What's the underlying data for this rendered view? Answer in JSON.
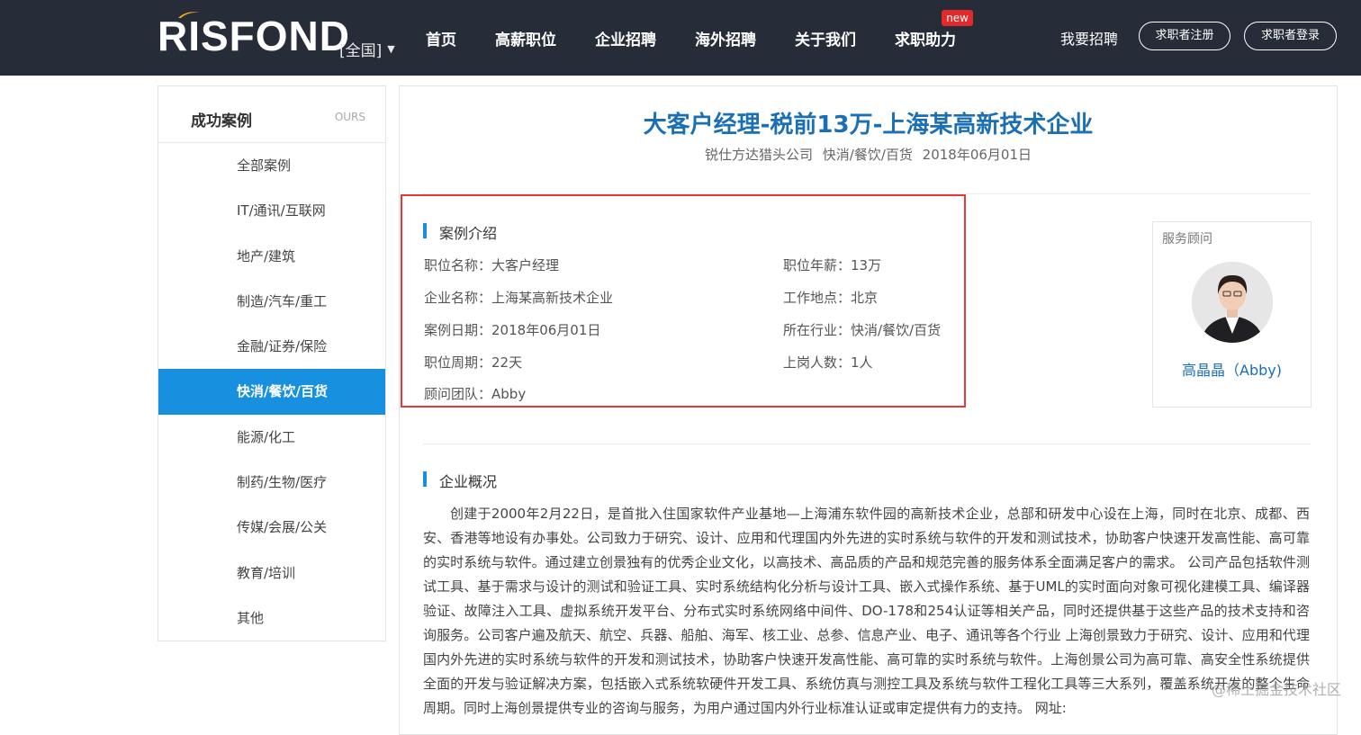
{
  "header": {
    "logo": "RISFOND",
    "region": "[全国]",
    "nav": [
      {
        "label": "首页"
      },
      {
        "label": "高薪职位"
      },
      {
        "label": "企业招聘"
      },
      {
        "label": "海外招聘"
      },
      {
        "label": "关于我们"
      },
      {
        "label": "求职助力",
        "badge": "new"
      }
    ],
    "recruit": "我要招聘",
    "register": "求职者注册",
    "login": "求职者登录"
  },
  "sidebar": {
    "title": "成功案例",
    "subtitle": "OURS",
    "items": [
      {
        "label": "全部案例"
      },
      {
        "label": "IT/通讯/互联网"
      },
      {
        "label": "地产/建筑"
      },
      {
        "label": "制造/汽车/重工"
      },
      {
        "label": "金融/证券/保险"
      },
      {
        "label": "快消/餐饮/百货"
      },
      {
        "label": "能源/化工"
      },
      {
        "label": "制药/生物/医疗"
      },
      {
        "label": "传媒/会展/公关"
      },
      {
        "label": "教育/培训"
      },
      {
        "label": "其他"
      }
    ],
    "active_index": 5
  },
  "case": {
    "title": "大客户经理-税前13万-上海某高新技术企业",
    "meta": "锐仕方达猎头公司   快消/餐饮/百货   2018年06月01日"
  },
  "intro": {
    "heading": "案例介绍",
    "fields": {
      "position_label": "职位名称：",
      "position": "大客户经理",
      "salary_label": "职位年薪：",
      "salary": "13万",
      "company_label": "企业名称：",
      "company": "上海某高新技术企业",
      "location_label": "工作地点：",
      "location": "北京",
      "date_label": "案例日期：",
      "date": "2018年06月01日",
      "industry_label": "所在行业：",
      "industry": "快消/餐饮/百货",
      "cycle_label": "职位周期：",
      "cycle": "22天",
      "hires_label": "上岗人数：",
      "hires": "1人",
      "team_label": "顾问团队：",
      "team": "Abby"
    }
  },
  "advisor": {
    "label": "服务顾问",
    "name": "高晶晶（Abby)"
  },
  "overview": {
    "heading": "企业概况",
    "text": "创建于2000年2月22日，是首批入住国家软件产业基地—上海浦东软件园的高新技术企业，总部和研发中心设在上海，同时在北京、成都、西安、香港等地设有办事处。公司致力于研究、设计、应用和代理国内外先进的实时系统与软件的开发和测试技术，协助客户快速开发高性能、高可靠的实时系统与软件。通过建立创景独有的优秀企业文化，以高技术、高品质的产品和规范完善的服务体系全面满足客户的需求。 公司产品包括软件测试工具、基于需求与设计的测试和验证工具、实时系统结构化分析与设计工具、嵌入式操作系统、基于UML的实时面向对象可视化建模工具、编译器验证、故障注入工具、虚拟系统开发平台、分布式实时系统网络中间件、DO-178和254认证等相关产品，同时还提供基于这些产品的技术支持和咨询服务。公司客户遍及航天、航空、兵器、船舶、海军、核工业、总参、信息产业、电子、通讯等各个行业 上海创景致力于研究、设计、应用和代理国内外先进的实时系统与软件的开发和测试技术，协助客户快速开发高性能、高可靠的实时系统与软件。上海创景公司为高可靠、高安全性系统提供全面的开发与验证解决方案，包括嵌入式系统软硬件开发工具、系统仿真与测控工具及系统与软件工程化工具等三大系列，覆盖系统开发的整个生命周期。同时上海创景提供专业的咨询与服务，为用户通过国内外行业标准认证或审定提供有力的支持。 网址:"
  },
  "watermark": "@稀土掘金技术社区",
  "colors": {
    "header_bg": "#272c39",
    "accent": "#1790e0",
    "title_blue": "#1a6fb5",
    "highlight_border": "#e23a3a"
  }
}
